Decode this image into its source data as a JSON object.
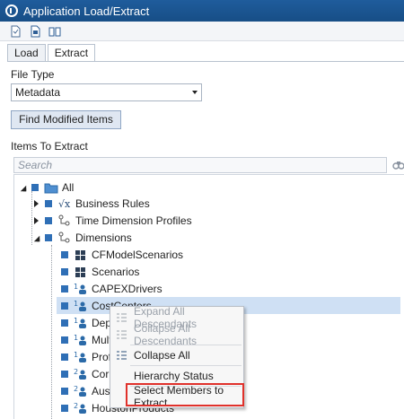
{
  "window": {
    "title": "Application Load/Extract"
  },
  "toolbar": {
    "icons": [
      "load-file-icon",
      "extract-file-icon",
      "help-book-icon"
    ]
  },
  "tabs": [
    {
      "label": "Load"
    },
    {
      "label": "Extract"
    }
  ],
  "file_type": {
    "label": "File Type",
    "value": "Metadata"
  },
  "find_button": {
    "label": "Find Modified Items"
  },
  "items": {
    "label": "Items To Extract",
    "search_placeholder": "Search"
  },
  "tree": {
    "rows": [
      {
        "label": "All"
      },
      {
        "label": "Business Rules"
      },
      {
        "label": "Time Dimension Profiles"
      },
      {
        "label": "Dimensions"
      },
      {
        "label": "CFModelScenarios"
      },
      {
        "label": "Scenarios"
      },
      {
        "label": "CAPEXDrivers"
      },
      {
        "label": "CostCenters"
      },
      {
        "label": "DeptN"
      },
      {
        "label": "MultiC"
      },
      {
        "label": "Profita"
      },
      {
        "label": "CorpP"
      },
      {
        "label": "Austin"
      },
      {
        "label": "HoustonProducts"
      }
    ]
  },
  "context_menu": {
    "items": [
      {
        "label": "Expand All Descendants"
      },
      {
        "label": "Collapse All Descendants"
      },
      {
        "label": "Collapse All"
      },
      {
        "label": "Hierarchy Status"
      },
      {
        "label": "Select Members to Extract"
      }
    ]
  },
  "colors": {
    "titlebar": "#1f5c9c",
    "selection": "#cfe0f4",
    "highlight": "#e0312b",
    "checkbox": "#2f6fb6"
  }
}
